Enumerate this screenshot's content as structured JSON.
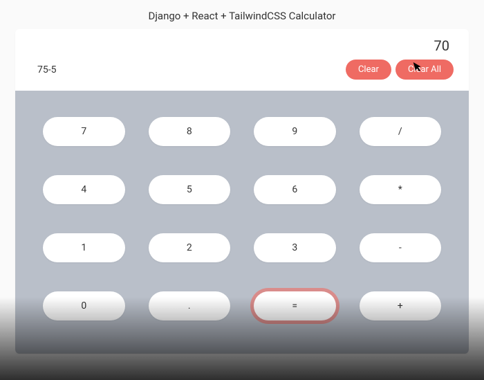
{
  "title": "Django + React + TailwindCSS Calculator",
  "display": {
    "result": "70",
    "expression": "75-5"
  },
  "actions": {
    "clear": "Clear",
    "clearAll": "Clear All"
  },
  "keys": [
    "7",
    "8",
    "9",
    "/",
    "4",
    "5",
    "6",
    "*",
    "1",
    "2",
    "3",
    "-",
    "0",
    ".",
    "=",
    "+"
  ],
  "colors": {
    "accent": "#ef6b63",
    "keypad_bg": "#b9bfc9"
  }
}
